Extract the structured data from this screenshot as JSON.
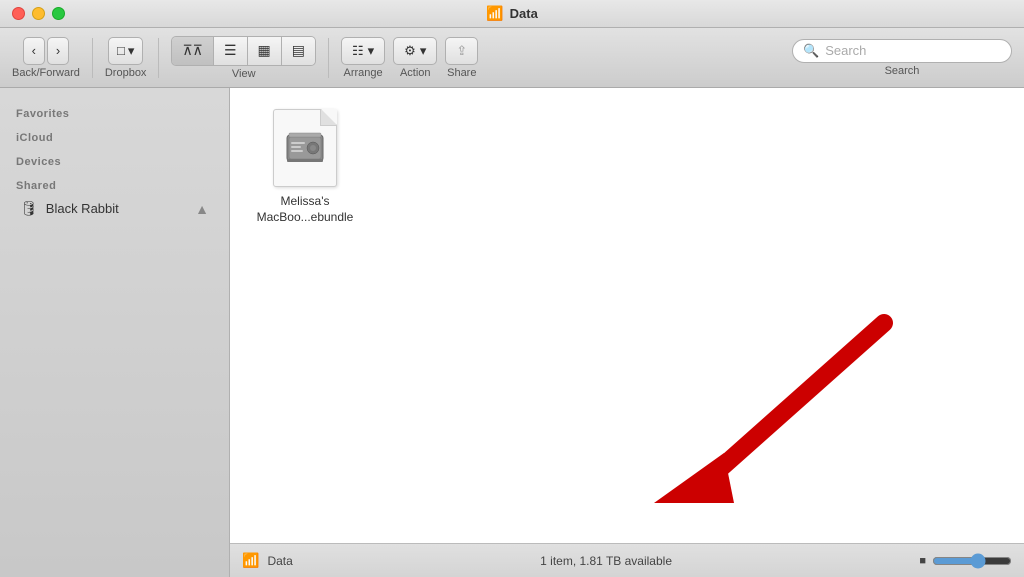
{
  "window": {
    "title": "Data",
    "title_icon": "📶"
  },
  "toolbar": {
    "back_label": "Back/Forward",
    "dropbox_label": "Dropbox",
    "view_label": "View",
    "arrange_label": "Arrange",
    "action_label": "Action",
    "share_label": "Share",
    "search_label": "Search",
    "search_placeholder": "Search"
  },
  "sidebar": {
    "sections": [
      {
        "label": "Favorites",
        "items": []
      },
      {
        "label": "iCloud",
        "items": []
      },
      {
        "label": "Devices",
        "items": []
      },
      {
        "label": "Shared",
        "items": [
          {
            "icon": "🖥",
            "name": "Black Rabbit",
            "eject": true
          }
        ]
      }
    ]
  },
  "content": {
    "file": {
      "name": "Melissa's\nMacBoo...ebundle"
    }
  },
  "status_bar": {
    "icon": "📶",
    "drive_name": "Data",
    "info": "1 item, 1.81 TB available"
  }
}
